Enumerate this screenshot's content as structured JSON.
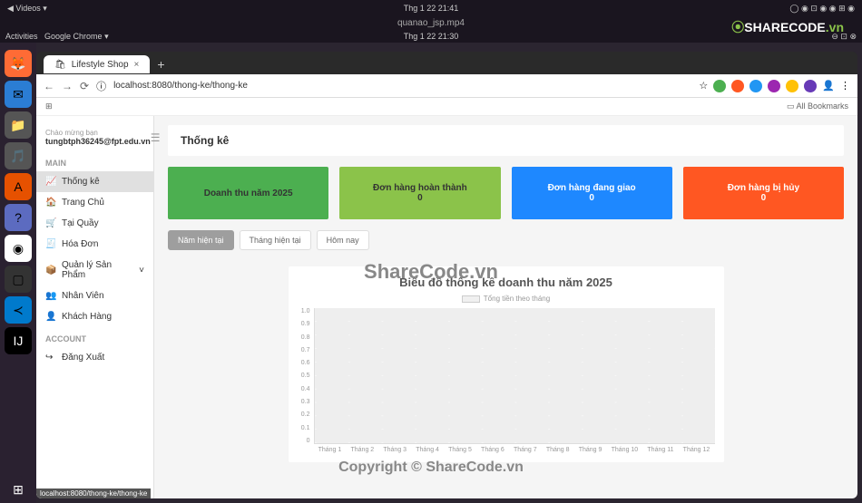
{
  "top": {
    "videos": "Videos ▾",
    "time": "Thg 1 22  21:41",
    "file": "quanao_jsp.mp4"
  },
  "activities": {
    "label": "Activities",
    "chrome": "Google Chrome ▾",
    "time2": "Thg 1 22  21:30"
  },
  "watermark": {
    "brand": "SHARECODE",
    "suffix": ".vn",
    "center": "ShareCode.vn",
    "bottom": "Copyright © ShareCode.vn"
  },
  "tab": {
    "title": "Lifestyle Shop"
  },
  "url": "localhost:8080/thong-ke/thong-ke",
  "bookmarks": {
    "all": "All Bookmarks"
  },
  "sidebar": {
    "greeting": "Chào mừng bạn",
    "email": "tungbtph36245@fpt.edu.vn",
    "main": "MAIN",
    "account": "ACCOUNT",
    "items": {
      "thongke": "Thống kê",
      "trangchu": "Trang Chủ",
      "taiquay": "Tại Quầy",
      "hoadon": "Hóa Đơn",
      "qlsp": "Quản lý Sản Phẩm",
      "nhanvien": "Nhân Viên",
      "khachhang": "Khách Hàng",
      "dangxuat": "Đăng Xuất"
    }
  },
  "page": {
    "title": "Thống kê"
  },
  "cards": {
    "revenue": {
      "label": "Doanh thu năm 2025"
    },
    "done": {
      "label": "Đơn hàng hoàn thành",
      "value": "0"
    },
    "shipping": {
      "label": "Đơn hàng đang giao",
      "value": "0"
    },
    "cancel": {
      "label": "Đơn hàng bị hủy",
      "value": "0"
    }
  },
  "filters": {
    "year": "Năm hiện tại",
    "month": "Tháng hiện tại",
    "today": "Hôm nay"
  },
  "chart_data": {
    "type": "bar",
    "title": "Biểu đồ thống kê doanh thu năm 2025",
    "legend": "Tổng tiền theo tháng",
    "categories": [
      "Tháng 1",
      "Tháng 2",
      "Tháng 3",
      "Tháng 4",
      "Tháng 5",
      "Tháng 6",
      "Tháng 7",
      "Tháng 8",
      "Tháng 9",
      "Tháng 10",
      "Tháng 11",
      "Tháng 12"
    ],
    "values": [
      0,
      0,
      0,
      0,
      0,
      0,
      0,
      0,
      0,
      0,
      0,
      0
    ],
    "y_ticks": [
      "1.0",
      "0.9",
      "0.8",
      "0.7",
      "0.6",
      "0.5",
      "0.4",
      "0.3",
      "0.2",
      "0.1",
      "0"
    ],
    "ylim": [
      0,
      1.0
    ]
  },
  "status": "localhost:8080/thong-ke/thong-ke"
}
